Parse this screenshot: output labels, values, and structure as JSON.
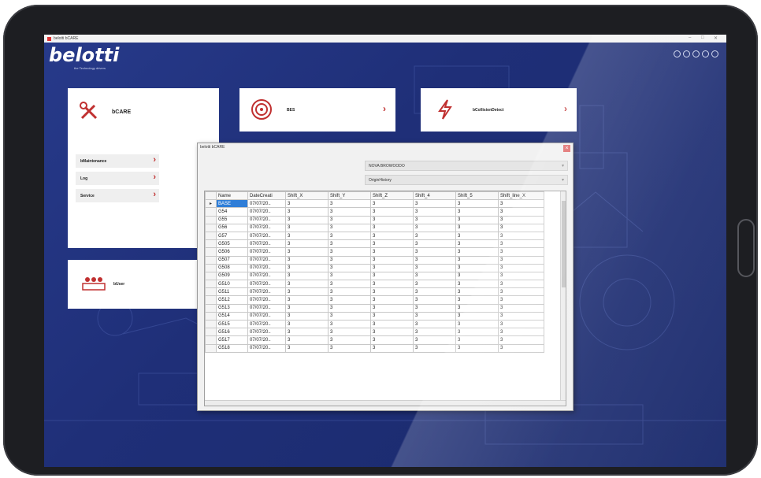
{
  "window": {
    "title": "belotti bCARE"
  },
  "logo": {
    "text": "belotti",
    "tagline": "the Technology drivers"
  },
  "top_icons": [
    "bell-icon",
    "user-icon",
    "document-icon",
    "info-icon",
    "power-icon"
  ],
  "cards": {
    "bcare": {
      "title": "bCARE",
      "items": [
        {
          "label": "bMaintenance"
        },
        {
          "label": "Log"
        },
        {
          "label": "Service"
        }
      ]
    },
    "bes": {
      "title": "BES"
    },
    "bcollision": {
      "title": "bCollisionDetect"
    },
    "bset": {
      "title": "bUser"
    }
  },
  "dialog": {
    "title": "belotti bCARE",
    "machine_combo": "NOVA BROWOODO",
    "table_combo": "OriginHistory",
    "columns": [
      "Name",
      "DateCreati",
      "Shift_X",
      "Shift_Y",
      "Shift_Z",
      "Shift_4",
      "Shift_5",
      "Shift_line_X"
    ],
    "rows": [
      [
        "BASE",
        "07/07/20..",
        "3",
        "3",
        "3",
        "3",
        "3",
        "3"
      ],
      [
        "G54",
        "07/07/20..",
        "3",
        "3",
        "3",
        "3",
        "3",
        "3"
      ],
      [
        "G55",
        "07/07/20..",
        "3",
        "3",
        "3",
        "3",
        "3",
        "3"
      ],
      [
        "G56",
        "07/07/20..",
        "3",
        "3",
        "3",
        "3",
        "3",
        "3"
      ],
      [
        "G57",
        "07/07/20..",
        "3",
        "3",
        "3",
        "3",
        "3",
        "3"
      ],
      [
        "G505",
        "07/07/20..",
        "3",
        "3",
        "3",
        "3",
        "3",
        "3"
      ],
      [
        "G506",
        "07/07/20..",
        "3",
        "3",
        "3",
        "3",
        "3",
        "3"
      ],
      [
        "G507",
        "07/07/20..",
        "3",
        "3",
        "3",
        "3",
        "3",
        "3"
      ],
      [
        "G508",
        "07/07/20..",
        "3",
        "3",
        "3",
        "3",
        "3",
        "3"
      ],
      [
        "G509",
        "07/07/20..",
        "3",
        "3",
        "3",
        "3",
        "3",
        "3"
      ],
      [
        "G510",
        "07/07/20..",
        "3",
        "3",
        "3",
        "3",
        "3",
        "3"
      ],
      [
        "G511",
        "07/07/20..",
        "3",
        "3",
        "3",
        "3",
        "3",
        "3"
      ],
      [
        "G512",
        "07/07/20..",
        "3",
        "3",
        "3",
        "3",
        "3",
        "3"
      ],
      [
        "G513",
        "07/07/20..",
        "3",
        "3",
        "3",
        "3",
        "3",
        "3"
      ],
      [
        "G514",
        "07/07/20..",
        "3",
        "3",
        "3",
        "3",
        "3",
        "3"
      ],
      [
        "G515",
        "07/07/20..",
        "3",
        "3",
        "3",
        "3",
        "3",
        "3"
      ],
      [
        "G516",
        "07/07/20..",
        "3",
        "3",
        "3",
        "3",
        "3",
        "3"
      ],
      [
        "G517",
        "07/07/20..",
        "3",
        "3",
        "3",
        "3",
        "3",
        "3"
      ],
      [
        "G518",
        "07/07/20..",
        "3",
        "3",
        "3",
        "3",
        "3",
        "3"
      ]
    ],
    "current_row_marker": "▸"
  },
  "colors": {
    "accent": "#c03030",
    "background": "#243580",
    "selection": "#2f7ed8"
  }
}
